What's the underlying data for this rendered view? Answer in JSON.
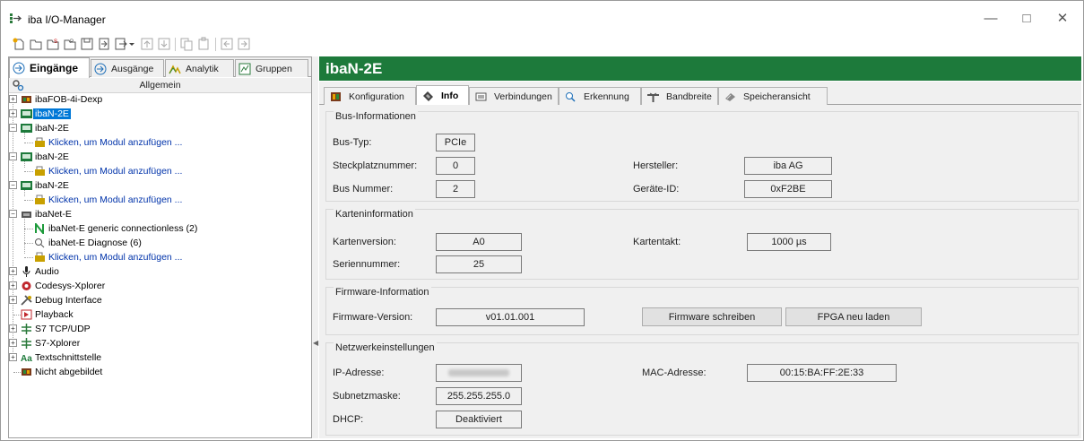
{
  "window": {
    "title": "iba I/O-Manager",
    "minimize": "—",
    "maximize": "□",
    "close": "✕"
  },
  "left_tabs": [
    {
      "label": "Eingänge",
      "icon": "input-arrow-icon"
    },
    {
      "label": "Ausgänge",
      "icon": "output-arrow-icon"
    },
    {
      "label": "Analytik",
      "icon": "analytics-icon"
    },
    {
      "label": "Gruppen",
      "icon": "groups-icon"
    }
  ],
  "group_header": "Allgemein",
  "tree": [
    {
      "label": "ibaFOB-4i-Dexp",
      "icon": "card-icon"
    },
    {
      "label": "ibaN-2E",
      "icon": "module-icon"
    },
    {
      "label": "ibaN-2E",
      "icon": "module-icon"
    },
    {
      "label": "Klicken, um Modul anzufügen ...",
      "icon": "add-module-icon"
    },
    {
      "label": "ibaN-2E",
      "icon": "module-icon"
    },
    {
      "label": "Klicken, um Modul anzufügen ...",
      "icon": "add-module-icon"
    },
    {
      "label": "ibaN-2E",
      "icon": "module-icon"
    },
    {
      "label": "Klicken, um Modul anzufügen ...",
      "icon": "add-module-icon"
    },
    {
      "label": "ibaNet-E",
      "icon": "network-icon"
    },
    {
      "label": "ibaNet-E generic connectionless (2)",
      "icon": "green-n-icon"
    },
    {
      "label": "ibaNet-E Diagnose (6)",
      "icon": "diagnose-icon"
    },
    {
      "label": "Klicken, um Modul anzufügen ...",
      "icon": "add-module-icon"
    },
    {
      "label": "Audio",
      "icon": "microphone-icon"
    },
    {
      "label": "Codesys-Xplorer",
      "icon": "codesys-icon"
    },
    {
      "label": "Debug Interface",
      "icon": "debug-icon"
    },
    {
      "label": "Playback",
      "icon": "playback-icon"
    },
    {
      "label": "S7 TCP/UDP",
      "icon": "s7-icon"
    },
    {
      "label": "S7-Xplorer",
      "icon": "s7-icon"
    },
    {
      "label": "Textschnittstelle",
      "icon": "text-icon"
    },
    {
      "label": "Nicht abgebildet",
      "icon": "card-icon"
    }
  ],
  "header_title": "ibaN-2E",
  "right_tabs": [
    {
      "label": "Konfiguration",
      "icon": "config-icon"
    },
    {
      "label": "Info",
      "icon": "info-icon"
    },
    {
      "label": "Verbindungen",
      "icon": "connections-icon"
    },
    {
      "label": "Erkennung",
      "icon": "detection-icon"
    },
    {
      "label": "Bandbreite",
      "icon": "bandwidth-icon"
    },
    {
      "label": "Speicheransicht",
      "icon": "memory-icon"
    }
  ],
  "bus": {
    "title": "Bus-Informationen",
    "bus_typ_label": "Bus-Typ:",
    "bus_typ": "PCIe",
    "steckplatz_label": "Steckplatznummer:",
    "steckplatz": "0",
    "bus_nummer_label": "Bus Nummer:",
    "bus_nummer": "2",
    "hersteller_label": "Hersteller:",
    "hersteller": "iba AG",
    "geraete_id_label": "Geräte-ID:",
    "geraete_id": "0xF2BE"
  },
  "karte": {
    "title": "Karteninformation",
    "version_label": "Kartenversion:",
    "version": "A0",
    "serien_label": "Seriennummer:",
    "serien": "25",
    "takt_label": "Kartentakt:",
    "takt": "1000 µs"
  },
  "firmware": {
    "title": "Firmware-Information",
    "version_label": "Firmware-Version:",
    "version": "v01.01.001",
    "write_button": "Firmware schreiben",
    "fpga_button": "FPGA neu laden"
  },
  "netz": {
    "title": "Netzwerkeinstellungen",
    "ip_label": "IP-Adresse:",
    "subnet_label": "Subnetzmaske:",
    "subnet": "255.255.255.0",
    "dhcp_label": "DHCP:",
    "dhcp": "Deaktiviert",
    "mac_label": "MAC-Adresse:",
    "mac": "00:15:BA:FF:2E:33"
  },
  "colors": {
    "header_green": "#1d7a3b",
    "selection": "#0078d7",
    "link": "#0033aa"
  }
}
